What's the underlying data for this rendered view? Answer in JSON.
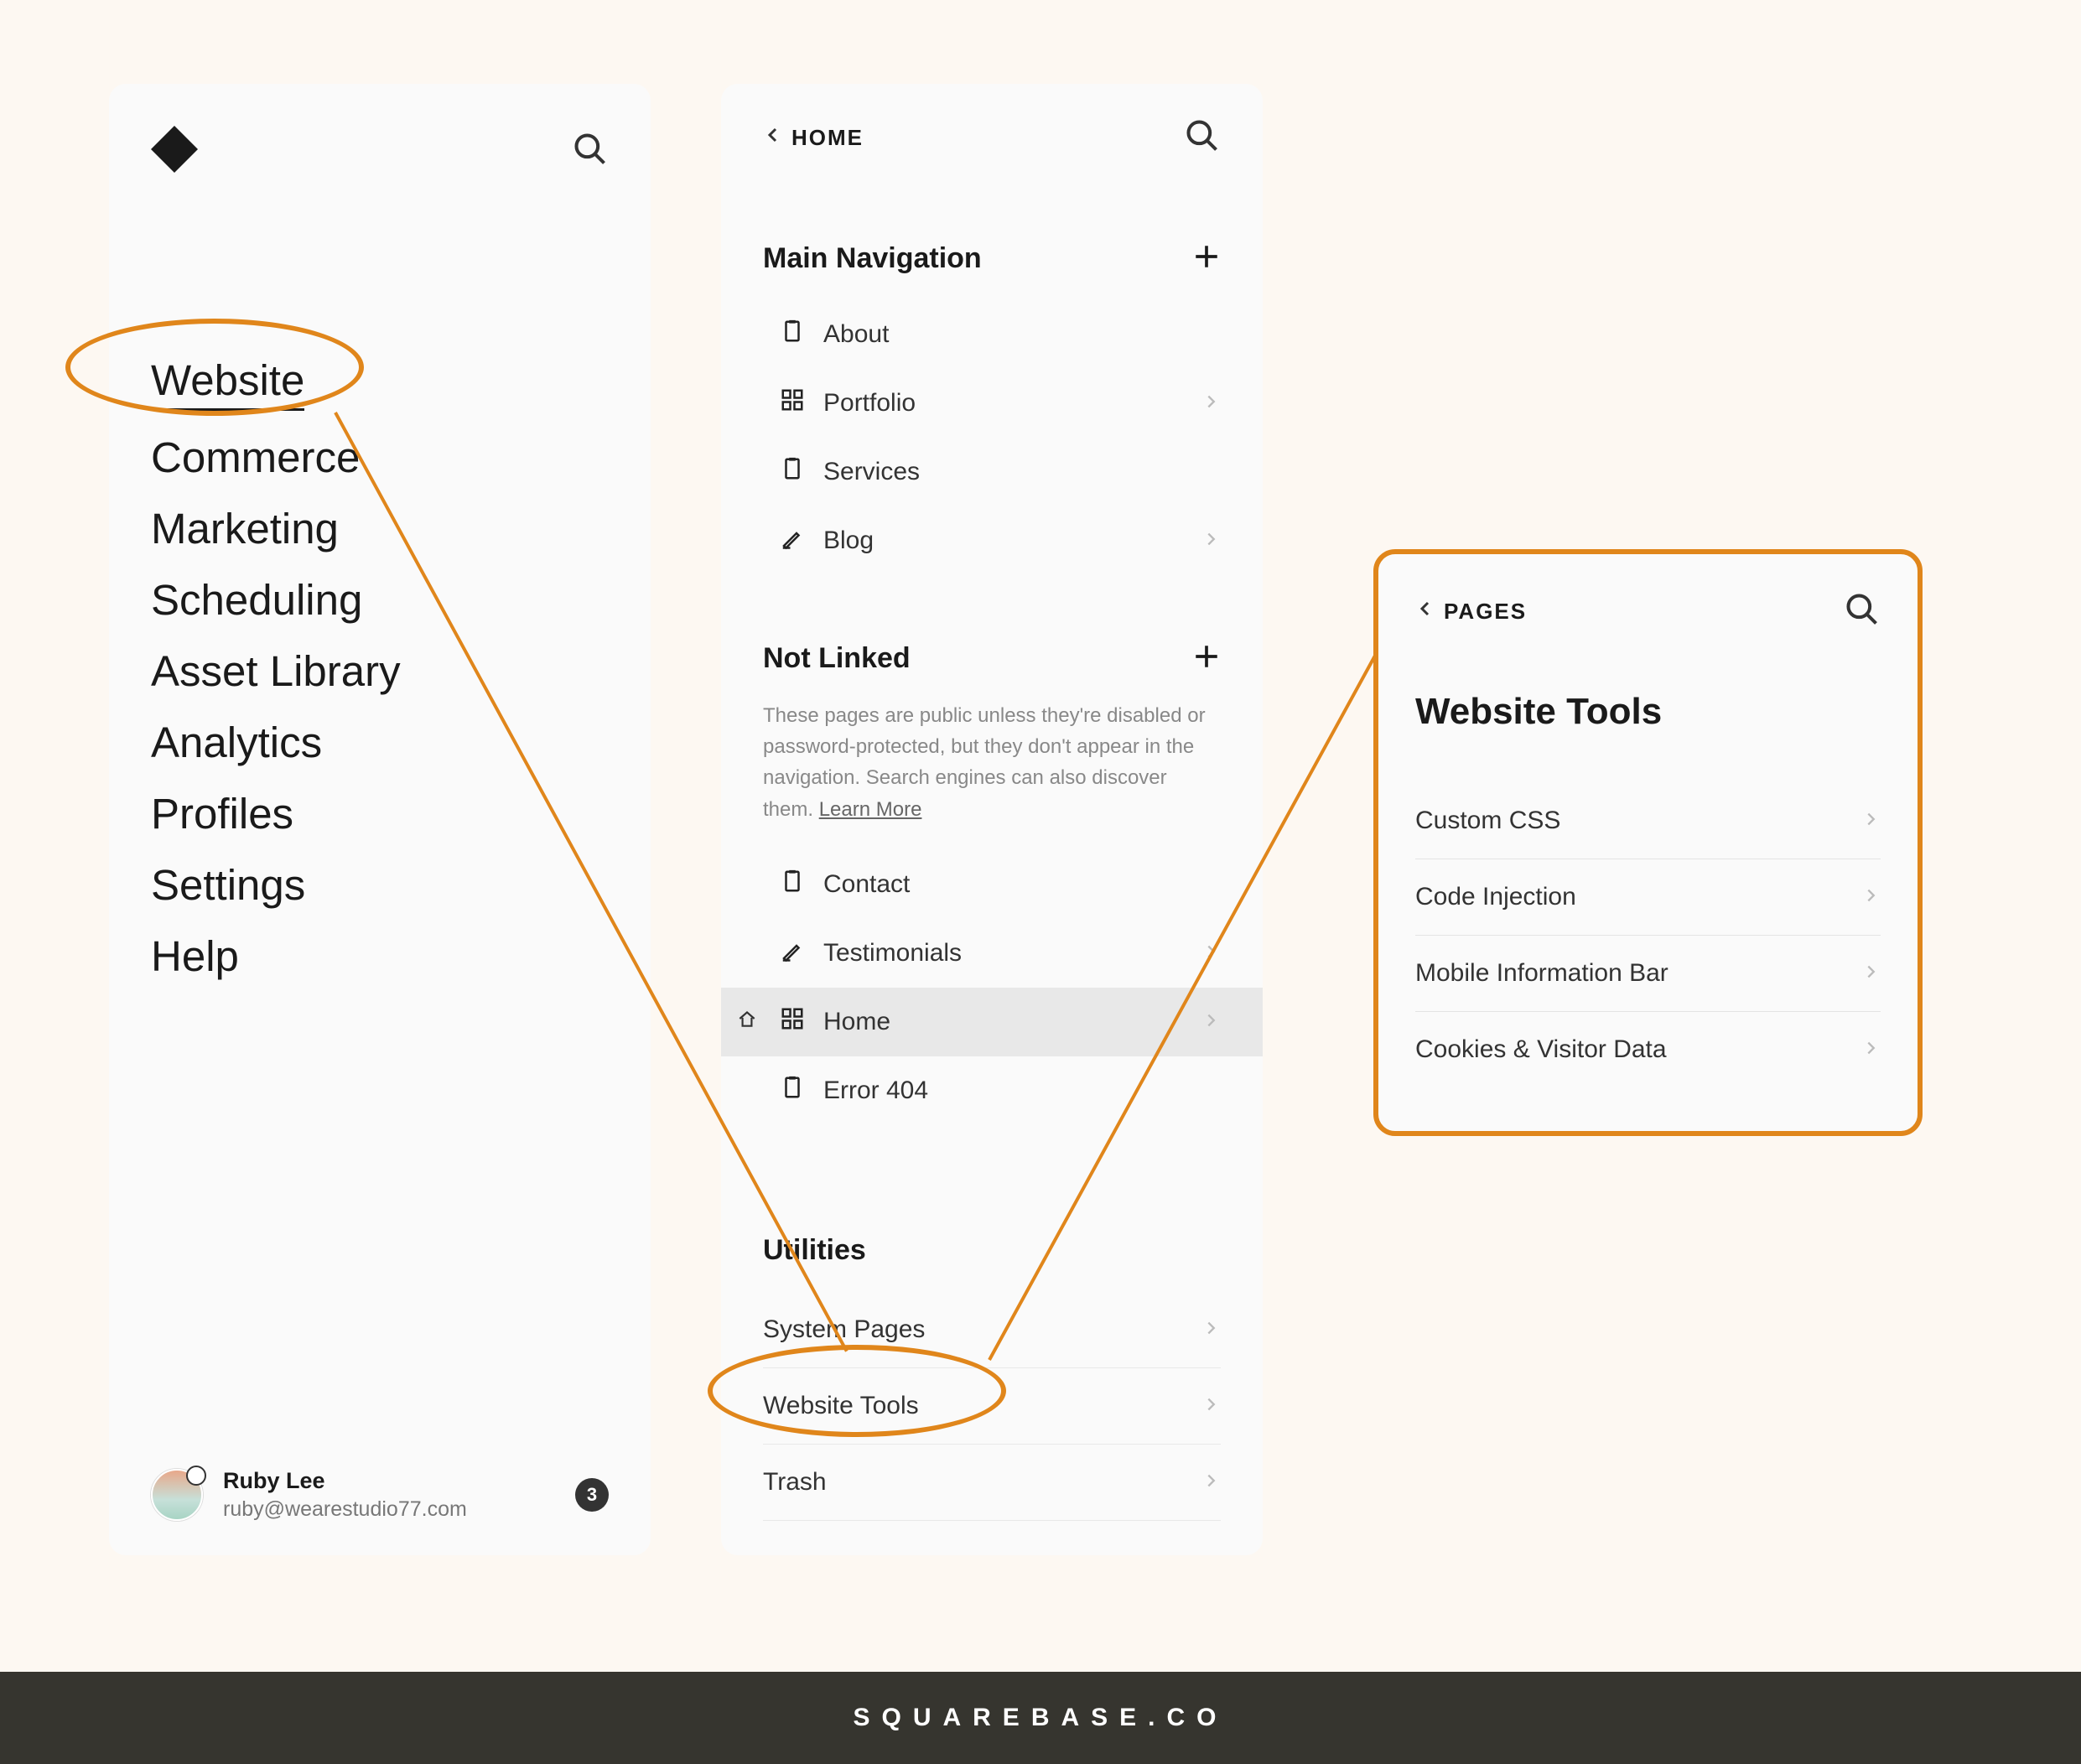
{
  "panel1": {
    "nav": [
      "Website",
      "Commerce",
      "Marketing",
      "Scheduling",
      "Asset Library",
      "Analytics",
      "Profiles",
      "Settings",
      "Help"
    ],
    "user": {
      "name": "Ruby Lee",
      "email": "ruby@wearestudio77.com",
      "badge": "3"
    }
  },
  "panel2": {
    "back_label": "HOME",
    "main_nav_title": "Main Navigation",
    "main_nav": [
      {
        "label": "About",
        "icon": "page",
        "chevron": false
      },
      {
        "label": "Portfolio",
        "icon": "grid",
        "chevron": true
      },
      {
        "label": "Services",
        "icon": "page",
        "chevron": false
      },
      {
        "label": "Blog",
        "icon": "brush",
        "chevron": true
      }
    ],
    "not_linked_title": "Not Linked",
    "not_linked_desc": "These pages are public unless they're disabled or password-protected, but they don't appear in the navigation. Search engines can also discover them. ",
    "not_linked_learn": "Learn More",
    "not_linked": [
      {
        "label": "Contact",
        "icon": "page",
        "chevron": false,
        "selected": false
      },
      {
        "label": "Testimonials",
        "icon": "brush",
        "chevron": true,
        "selected": false
      },
      {
        "label": "Home",
        "icon": "grid",
        "chevron": true,
        "selected": true
      },
      {
        "label": "Error 404",
        "icon": "page",
        "chevron": false,
        "selected": false
      }
    ],
    "utilities_title": "Utilities",
    "utilities": [
      "System Pages",
      "Website Tools",
      "Trash"
    ]
  },
  "panel3": {
    "back_label": "PAGES",
    "heading": "Website Tools",
    "tools": [
      "Custom CSS",
      "Code Injection",
      "Mobile Information Bar",
      "Cookies & Visitor Data"
    ]
  },
  "footer_text": "SQUAREBASE.CO",
  "annotation": {
    "accent": "#e0861b"
  }
}
